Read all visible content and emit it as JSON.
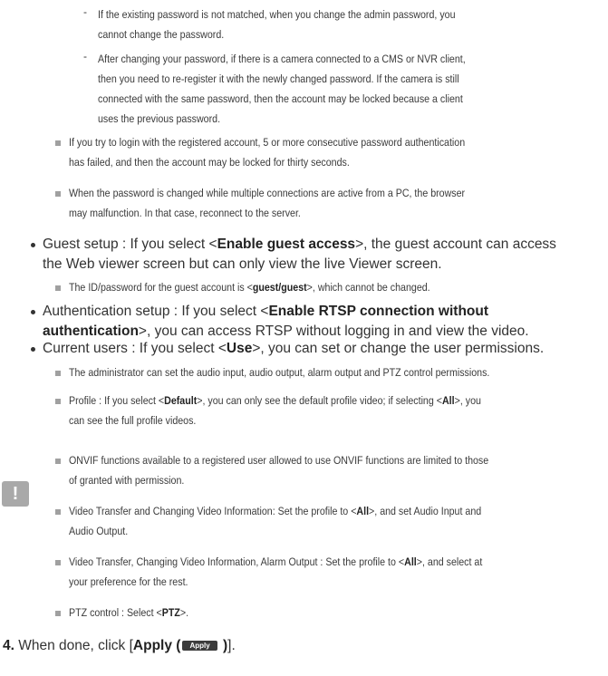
{
  "dash_items": [
    {
      "l1": "If the existing password is not matched, when you change the admin password, you",
      "l2": "cannot change the password."
    },
    {
      "l1": "After changing your password, if there is a camera connected to a CMS or NVR client,",
      "l2": "then you need to re-register it with the newly changed password. If the camera is still",
      "l3": "connected with the same password, then the account may be locked because a client",
      "l4": "uses the previous password."
    }
  ],
  "notes": [
    {
      "l1": "If you try to login with the registered account, 5 or more consecutive password authentication",
      "l2": "has failed, and then the account may be locked for thirty seconds."
    },
    {
      "l1": "When the password is changed while multiple connections are active from a PC, the browser",
      "l2": "may malfunction. In that case, reconnect to the server."
    }
  ],
  "guest": {
    "pre": "Guest setup : If you select <",
    "bold": "Enable guest access",
    "post": ">, the guest account can access",
    "l2": "the Web viewer screen but can only view the live Viewer screen.",
    "sub_pre": "The ID/password for the guest account is <",
    "sub_bold": "guest/guest",
    "sub_post": ">, which cannot be changed."
  },
  "auth": {
    "pre": "Authentication setup : If you select <",
    "bold1": "Enable RTSP connection without",
    "bold2": "authentication",
    "post": ">, you can access RTSP without logging in and view the video."
  },
  "current": {
    "pre": "Current users : If you select <",
    "bold": "Use",
    "post": ">, you can set or change the user permissions.",
    "sub1": "The administrator can set the audio input, audio output, alarm output and PTZ control permissions.",
    "sub2_pre": "Profile : If you select <",
    "sub2_b1": "Default",
    "sub2_mid": ">, you can only see the default profile video; if selecting <",
    "sub2_b2": "All",
    "sub2_post": ">, you",
    "sub2_l2": "can see the full profile videos."
  },
  "caution": {
    "icon": "!",
    "n1_l1": "ONVIF functions available to a registered user allowed to use ONVIF functions are limited to those",
    "n1_l2": "of granted with permission.",
    "n2_pre": "Video Transfer and Changing Video Information: Set the profile to <",
    "n2_bold": "All",
    "n2_post": ">, and set Audio Input and",
    "n2_l2": "Audio Output.",
    "n3_pre": "Video Transfer, Changing Video Information, Alarm Output : Set the profile to <",
    "n3_bold": "All",
    "n3_post": ">, and select at",
    "n3_l2": "your preference for the rest.",
    "n4_pre": "PTZ control : Select <",
    "n4_bold": "PTZ",
    "n4_post": ">."
  },
  "step4": {
    "num": "4.",
    "pre": "When done, click [",
    "bold": "Apply (",
    "button": "Apply",
    "post_bold": " )",
    "post": "]."
  }
}
